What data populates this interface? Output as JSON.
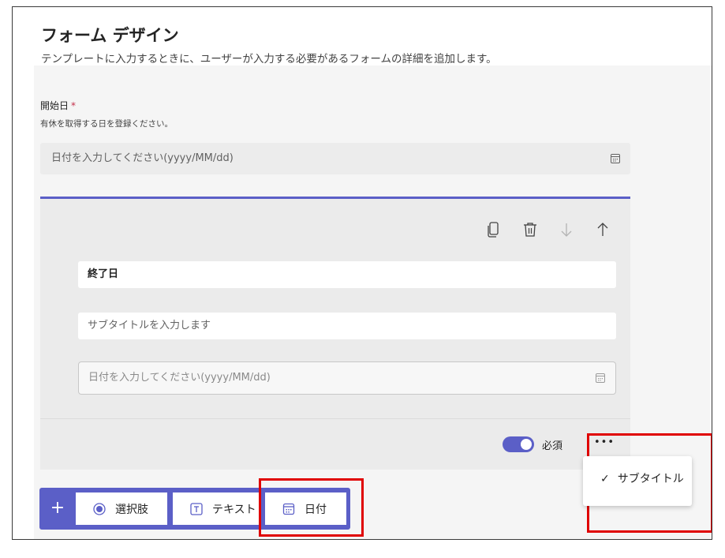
{
  "header": {
    "title": "フォーム デザイン",
    "subtitle": "テンプレートに入力するときに、ユーザーが入力する必要があるフォームの詳細を追加します。"
  },
  "start_field": {
    "label": "開始日",
    "required_mark": "*",
    "description": "有休を取得する日を登録ください。",
    "placeholder": "日付を入力してください(yyyy/MM/dd)",
    "icon": "calendar-icon"
  },
  "edit_card": {
    "tools": [
      "copy-icon",
      "delete-icon",
      "move-down-icon",
      "move-up-icon"
    ],
    "title_value": "終了日",
    "subtitle_placeholder": "サブタイトルを入力します",
    "date_placeholder": "日付を入力してください(yyyy/MM/dd)",
    "required_label": "必須",
    "required_on": true,
    "more_label": "•••",
    "accent_color": "#5b5fc7"
  },
  "more_menu": {
    "items": [
      {
        "check": "✓",
        "label": "サブタイトル",
        "checked": true
      }
    ]
  },
  "add_toolbar": {
    "plus_label": "+",
    "buttons": [
      {
        "label": "選択肢",
        "icon": "radio-icon"
      },
      {
        "label": "テキスト",
        "icon": "text-box-icon"
      },
      {
        "label": "日付",
        "icon": "calendar-icon"
      }
    ],
    "background_color": "#5b5fc7"
  },
  "highlight_color": "#e00000"
}
